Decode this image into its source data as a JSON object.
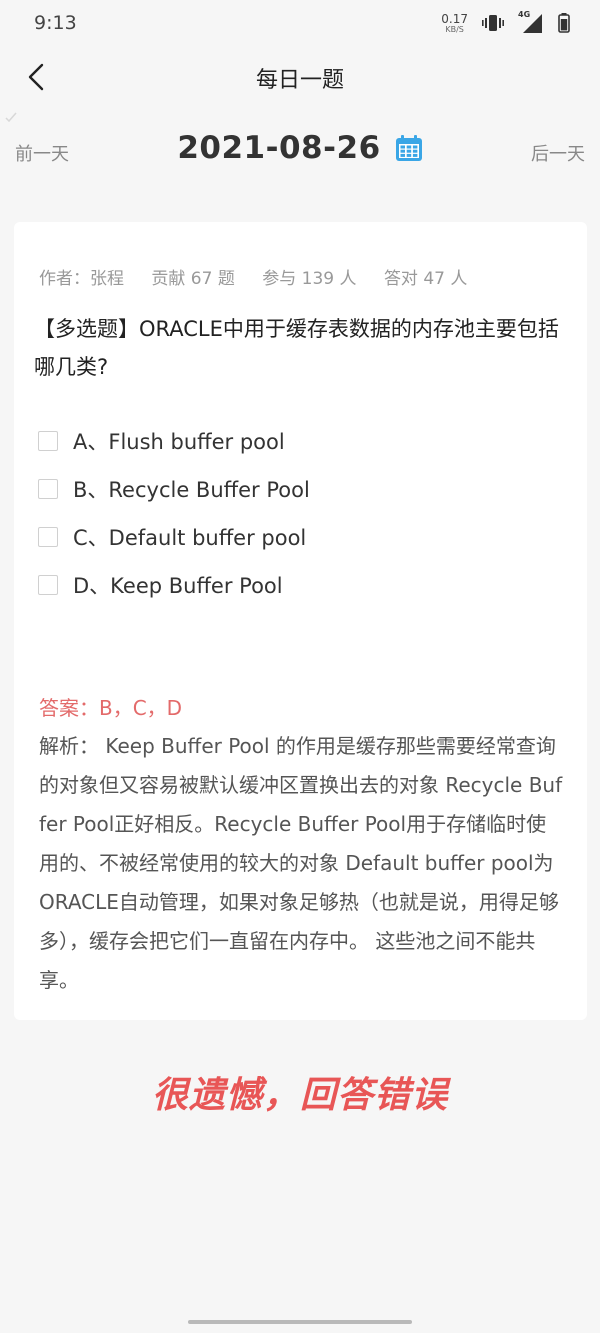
{
  "status": {
    "time": "9:13",
    "net_speed_value": "0.17",
    "net_speed_unit": "KB/S",
    "network": "4G",
    "icons": [
      "vibrate-icon",
      "signal-icon",
      "battery-icon"
    ]
  },
  "nav": {
    "title": "每日一题",
    "back_icon": "chevron-left-icon"
  },
  "date_nav": {
    "prev": "前一天",
    "date": "2021-08-26",
    "next": "后一天",
    "calendar_icon": "calendar-icon"
  },
  "meta": {
    "author": "作者：张程",
    "contribution": "贡献 67 题",
    "participants": "参与 139 人",
    "correct": "答对 47 人"
  },
  "question": {
    "text": "【多选题】ORACLE中用于缓存表数据的内存池主要包括哪几类?",
    "options": [
      {
        "label": "A、Flush buffer pool"
      },
      {
        "label": "B、Recycle Buffer Pool"
      },
      {
        "label": "C、Default buffer pool"
      },
      {
        "label": "D、Keep Buffer Pool"
      }
    ]
  },
  "answer": "答案：B，C，D",
  "analysis": "解析： Keep Buffer Pool 的作用是缓存那些需要经常查询的对象但又容易被默认缓冲区置换出去的对象 Recycle Buffer Pool正好相反。Recycle Buffer Pool用于存储临时使用的、不被经常使用的较大的对象 Default buffer pool为ORACLE自动管理，如果对象足够热（也就是说，用得足够多），缓存会把它们一直留在内存中。 这些池之间不能共享。",
  "result": "很遗憾，回答错误",
  "colors": {
    "accent_blue": "#3aa6e6",
    "answer_red": "#e36a6a",
    "result_red": "#e85656"
  }
}
